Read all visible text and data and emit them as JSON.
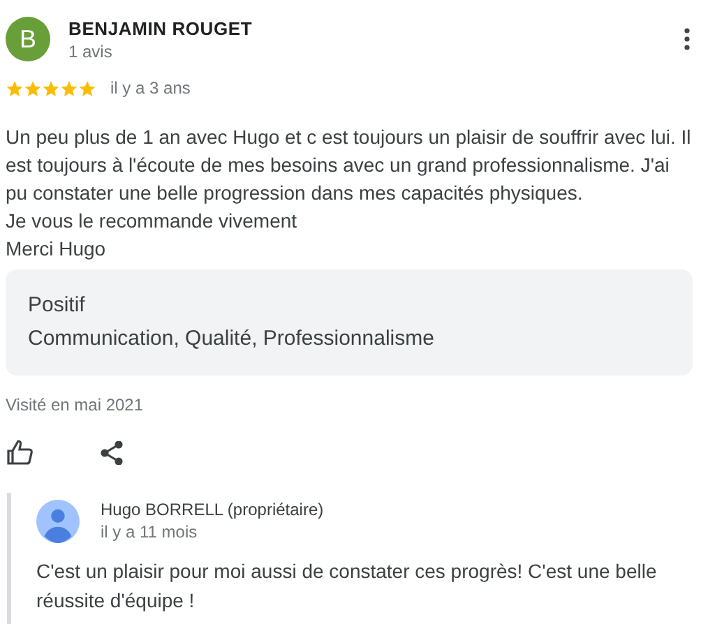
{
  "reviewer": {
    "initial": "B",
    "name": "BENJAMIN ROUGET",
    "reviews": "1 avis"
  },
  "rating": {
    "stars": 5,
    "time": "il y a 3 ans"
  },
  "review_lines": [
    "Un peu plus de 1 an avec Hugo et c est toujours un plaisir de souffrir avec lui. Il est toujours à l'écoute de mes besoins avec un grand professionnalisme. J'ai pu constater une belle progression dans mes capacités physiques.",
    "Je vous le recommande vivement",
    "Merci Hugo"
  ],
  "highlights": {
    "title": "Positif",
    "text": "Communication, Qualité, Professionnalisme"
  },
  "visited": "Visité en mai 2021",
  "reply": {
    "name": "Hugo BORRELL (propriétaire)",
    "time": "il y a 11 mois",
    "text": "C'est un plaisir pour moi aussi de constater ces progrès! C'est une belle réussite d'équipe !"
  }
}
